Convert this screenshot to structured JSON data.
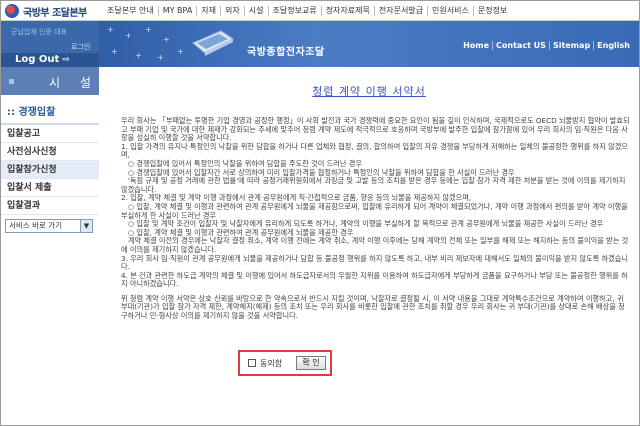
{
  "header": {
    "agency": "국방부 조달본부",
    "nav": [
      "조달본부 안내",
      "MY BPA",
      "자재",
      "외자",
      "시설",
      "조달정보교류",
      "정자자료제목",
      "전자문서발급",
      "민원서비스",
      "문정정보"
    ]
  },
  "sidebar": {
    "login_line1": "군납업체 인증 대표",
    "login_line2": "",
    "login_line3": "로그인",
    "logout_label": "Log Out",
    "section_title": "시 설",
    "menu_title": ":: 경쟁입찰",
    "items": [
      "입찰공고",
      "사전심사신청",
      "입찰참가신청",
      "입찰서 제출",
      "입찰결과"
    ],
    "active_index": 2,
    "quick_select": "서비스 바로 가기"
  },
  "banner": {
    "site_name": "국방종합전자조달",
    "nav": [
      "Home",
      "Contact US",
      "Sitemap",
      "English"
    ]
  },
  "document": {
    "title": "청렴 계약 이행 서약서",
    "paragraphs": [
      "우리 회사는 「부패없는 투명한 기업 경영과 공정한 행정」이 사회 발전과 국가 경쟁력에 중요한 요인이 됨을 깊이 인식하며, 국제적으로도 OECD 뇌물방지 협약이 발효되고 부패 기업 및 국가에 대한 제재가 강화되는 추세에 맞추어 청렴 계약 제도에 적극적으로 호응하며 국방부에 발주한 입찰에 참가함에 있어 우리 회사의 임·직원은 다음 사항을 성실히 이행할 것을 서약합니다.",
      "1. 입찰 가격의 유지나 특정인의 낙찰을 위한 담합을 하거나 다른 업체와 협정, 결의, 합의하여 입찰의 자유 경쟁을 부당하게 저해하는 일체의 불공정한 행위를 하지 않겠으며,",
      "   ○ 경쟁입찰에 있어서 특정인의 낙찰을 위하여 담합을 주도한 것이 드러난 경우",
      "   ○ 경쟁입찰에 있어서 입찰자간 서로 상의하여 미리 입찰가격을 협정하거나 특정인의 낙찰을 위하여 담합을 한 사실이 드러난 경우",
      "   '독점 규제 및 공정 거래에 관한 법률'에 따라 공정거래위원회에서 과징금 및 고발 등의 조치를 받은 경우 등에는 입찰 참가 자격 제한 처분을 받는 것에 이의를 제기하지 않겠습니다.",
      "2. 입찰, 계약 체결 및 계약 이행 과정에서 관계 공무원에게 직·간접적으로 금품, 향응 등의 뇌물을 제공하지 않겠으며,",
      "   ○ 입찰, 계약 체결 및 이행과 관련하여 관계 공무원에게 뇌물을 제공함으로써, 입찰에 유리하게 되어 계약이 체결되었거나, 계약 이행 과정에서 편의를 받아 계약 이행을 부실하게 한 사실이 드러난 경우",
      "   ○ 입찰 및 계약 조건이 입찰자 및 낙찰자에게 유리하게 되도록 하거나, 계약의 이행을 부실하게 할 목적으로 관계 공무원에게 뇌물을 제공한 사실이 드러난 경우",
      "   ○ 입찰, 계약 체결 및 이행과 관련하여 관계 공무원에게 뇌물을 제공한 경우",
      "   계약 체결 이전의 경우에는 낙찰자 결정 취소, 계약 이행 전에는 계약 취소, 계약 이행 이후에는 당해 계약의 전체 또는 일부를 해제 또는 해지하는 등의 불이익을 받는 것에 이의를 제기하지 않겠습니다.",
      "3. 우리 회사 임·직원이 관계 공무원에게 뇌물을 제공하거나 담합 등 불공정 행위를 하지 않도록 하고, 내부 비리 제보자에 대해서도 일체의 불이익을 받지 않도록 하겠습니다.",
      "4. 본 건과 관련한 하도급 계약의 체결 및 이행에 있어서 하도급자로서의 우월한 지위를 이용하여 하도급자에게 부당하게 금품을 요구하거나 부당 또는 불공정한 행위를 하지 아니하겠습니다.",
      "",
      "위 청렴 계약 이행 서약은 상호 신뢰를 바탕으로 한 약속으로서 반드시 지킬 것이며, 낙찰자로 결정될 시, 이 서약 내용을 그대로 계약특수조건으로 계약하여 이행하고, 귀 부대(기관)가 입찰 참가 자격 제한, 계약해지(해제) 등의 조치 또는 우리 회사를 비롯한 입찰에 관한 조치를 취할 경우 우리 회사는 귀 부대(기관)를 상대로 손해 배상을 청구하거나 민·형사상 이의를 제기하지 않을 것을 서약합니다."
    ]
  },
  "agreement": {
    "checkbox_label": "동의함",
    "confirm_label": "확 인"
  }
}
